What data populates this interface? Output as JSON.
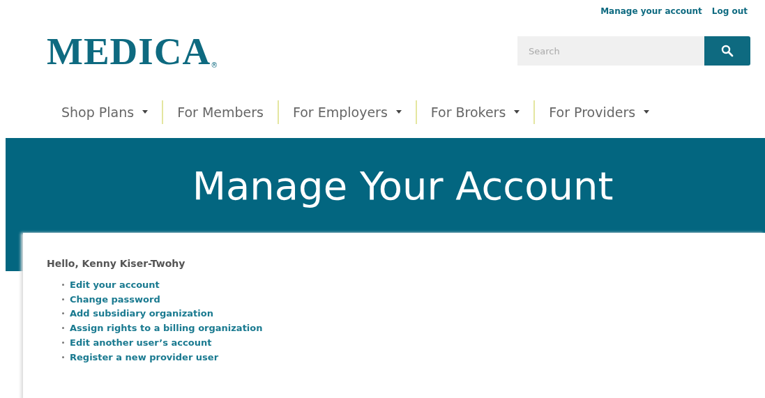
{
  "top_links": [
    "Manage your account",
    "Log out"
  ],
  "logo": {
    "text": "MEDICA",
    "mark": "®"
  },
  "search": {
    "placeholder": "Search"
  },
  "nav": [
    {
      "label": "Shop Plans",
      "dropdown": true
    },
    {
      "label": "For Members",
      "dropdown": false
    },
    {
      "label": "For Employers",
      "dropdown": true
    },
    {
      "label": "For Brokers",
      "dropdown": true
    },
    {
      "label": "For Providers",
      "dropdown": true
    }
  ],
  "banner": {
    "title": "Manage Your Account"
  },
  "greeting": "Hello, Kenny Kiser-Twohy",
  "links": [
    "Edit your account",
    "Change password",
    "Add subsidiary organization",
    "Assign rights to a billing organization",
    "Edit another user’s account",
    "Register a new provider user"
  ]
}
